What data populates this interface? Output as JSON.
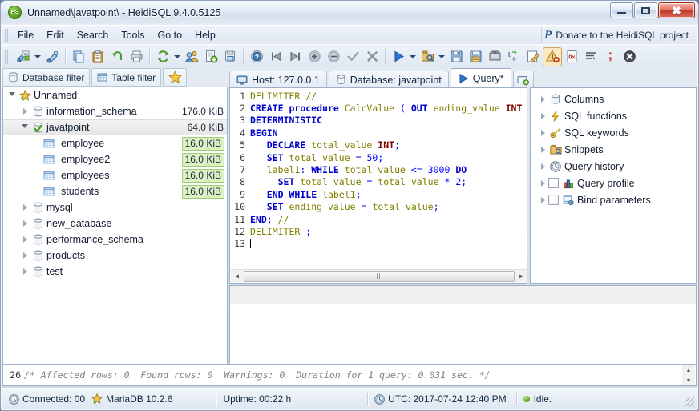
{
  "window": {
    "title": "Unnamed\\javatpoint\\ - HeidiSQL 9.4.0.5125",
    "app_icon": "HS",
    "minimize_label": "Minimize",
    "maximize_label": "Maximize",
    "close_label": "Close"
  },
  "menubar": {
    "items": [
      {
        "label": "File",
        "name": "menu-file"
      },
      {
        "label": "Edit",
        "name": "menu-edit"
      },
      {
        "label": "Search",
        "name": "menu-search"
      },
      {
        "label": "Tools",
        "name": "menu-tools"
      },
      {
        "label": "Go to",
        "name": "menu-goto"
      },
      {
        "label": "Help",
        "name": "menu-help"
      }
    ],
    "donate": {
      "icon": "paypal-icon",
      "glyph": "P",
      "label": "Donate to the HeidiSQL project"
    }
  },
  "toolbar": {
    "buttons": [
      {
        "name": "session-manager-icon",
        "tip": "Session manager"
      },
      {
        "name": "session-dropdown-caret",
        "tip": "Open session dropdown"
      },
      {
        "name": "new-session-icon",
        "tip": "Create new session"
      },
      {
        "name": "copy-icon",
        "tip": "Copy"
      },
      {
        "name": "paste-icon",
        "tip": "Paste"
      },
      {
        "name": "undo-icon",
        "tip": "Undo"
      },
      {
        "name": "print-icon",
        "tip": "Print"
      },
      {
        "name": "refresh-icon",
        "tip": "Refresh"
      },
      {
        "name": "refresh-dropdown-caret",
        "tip": "Refresh options"
      },
      {
        "name": "user-manager-icon",
        "tip": "User manager"
      },
      {
        "name": "export-database-icon",
        "tip": "Export database as SQL"
      },
      {
        "name": "import-dump-icon",
        "tip": "Import SQL dump"
      },
      {
        "name": "help-icon",
        "tip": "Help"
      },
      {
        "name": "first-icon",
        "tip": "First"
      },
      {
        "name": "last-icon",
        "tip": "Last"
      },
      {
        "name": "insert-row-icon",
        "tip": "Insert row"
      },
      {
        "name": "delete-row-icon",
        "tip": "Delete row"
      },
      {
        "name": "apply-icon",
        "tip": "Apply changes"
      },
      {
        "name": "cancel-icon",
        "tip": "Cancel changes"
      },
      {
        "name": "execute-sql-icon",
        "tip": "Execute SQL"
      },
      {
        "name": "execute-dropdown-caret",
        "tip": "Execute options"
      },
      {
        "name": "load-sql-icon",
        "tip": "Load SQL file"
      },
      {
        "name": "load-dropdown-caret",
        "tip": "Load options"
      },
      {
        "name": "save-sql-icon",
        "tip": "Save SQL"
      },
      {
        "name": "save-as-sql-icon",
        "tip": "Save SQL as"
      },
      {
        "name": "find-replace-icon",
        "tip": "Find / replace"
      },
      {
        "name": "format-sql-icon",
        "tip": "Format SQL"
      },
      {
        "name": "edit-highlight-icon",
        "tip": "Edit"
      },
      {
        "name": "stop-on-errors-icon",
        "tip": "Stop on errors",
        "pressed": true
      },
      {
        "name": "hex-view-icon",
        "tip": "Hex view"
      },
      {
        "name": "word-wrap-icon",
        "tip": "Word wrap"
      },
      {
        "name": "semicolon-icon",
        "tip": "Delimiter"
      },
      {
        "name": "close-tab-icon",
        "tip": "Close query tab"
      }
    ]
  },
  "left_panel": {
    "filter_tabs": [
      {
        "label": "Database filter",
        "icon": "database-icon",
        "name": "tab-database-filter"
      },
      {
        "label": "Table filter",
        "icon": "table-icon",
        "name": "tab-table-filter"
      }
    ],
    "favorites_icon": "star-icon",
    "tree": [
      {
        "label": "Unnamed",
        "size": "",
        "icon": "session-icon",
        "indent": 0,
        "expander": "open",
        "selected": false
      },
      {
        "label": "information_schema",
        "size": "176.0 KiB",
        "icon": "database-icon",
        "indent": 1,
        "expander": "closed",
        "selected": false
      },
      {
        "label": "javatpoint",
        "size": "64.0 KiB",
        "icon": "database-active-icon",
        "indent": 1,
        "expander": "open",
        "selected": true
      },
      {
        "label": "employee",
        "size": "16.0 KiB",
        "icon": "table-icon",
        "indent": 2,
        "expander": "none",
        "selected": false,
        "size_badge": true
      },
      {
        "label": "employee2",
        "size": "16.0 KiB",
        "icon": "table-icon",
        "indent": 2,
        "expander": "none",
        "selected": false,
        "size_badge": true
      },
      {
        "label": "employees",
        "size": "16.0 KiB",
        "icon": "table-icon",
        "indent": 2,
        "expander": "none",
        "selected": false,
        "size_badge": true
      },
      {
        "label": "students",
        "size": "16.0 KiB",
        "icon": "table-icon",
        "indent": 2,
        "expander": "none",
        "selected": false,
        "size_badge": true
      },
      {
        "label": "mysql",
        "size": "",
        "icon": "database-icon",
        "indent": 1,
        "expander": "closed",
        "selected": false
      },
      {
        "label": "new_database",
        "size": "",
        "icon": "database-icon",
        "indent": 1,
        "expander": "closed",
        "selected": false
      },
      {
        "label": "performance_schema",
        "size": "",
        "icon": "database-icon",
        "indent": 1,
        "expander": "closed",
        "selected": false
      },
      {
        "label": "products",
        "size": "",
        "icon": "database-icon",
        "indent": 1,
        "expander": "closed",
        "selected": false
      },
      {
        "label": "test",
        "size": "",
        "icon": "database-icon",
        "indent": 1,
        "expander": "closed",
        "selected": false
      }
    ]
  },
  "tabs": [
    {
      "label": "Host: 127.0.0.1",
      "icon": "host-icon",
      "active": false,
      "name": "tab-host"
    },
    {
      "label": "Database: javatpoint",
      "icon": "database-icon",
      "active": false,
      "name": "tab-database"
    },
    {
      "label": "Query*",
      "icon": "play-icon",
      "active": true,
      "name": "tab-query"
    }
  ],
  "new_tab_icon": "add-query-tab-icon",
  "editor": {
    "lines": [
      {
        "n": "1",
        "tokens": [
          {
            "t": "DELIMITER",
            "c": "ko"
          },
          {
            "t": " //",
            "c": "cm"
          }
        ]
      },
      {
        "n": "2",
        "tokens": [
          {
            "t": "CREATE",
            "c": "k"
          },
          {
            "t": " ",
            "c": "pl"
          },
          {
            "t": "procedure",
            "c": "k"
          },
          {
            "t": " ",
            "c": "pl"
          },
          {
            "t": "CalcValue",
            "c": "ko"
          },
          {
            "t": " ",
            "c": "pl"
          },
          {
            "t": "(",
            "c": "num"
          },
          {
            "t": " ",
            "c": "pl"
          },
          {
            "t": "OUT",
            "c": "k"
          },
          {
            "t": " ",
            "c": "pl"
          },
          {
            "t": "ending_value",
            "c": "ko"
          },
          {
            "t": " ",
            "c": "pl"
          },
          {
            "t": "INT",
            "c": "kt"
          }
        ]
      },
      {
        "n": "3",
        "tokens": [
          {
            "t": "DETERMINISTIC",
            "c": "k"
          }
        ]
      },
      {
        "n": "4",
        "tokens": [
          {
            "t": "BEGIN",
            "c": "k"
          }
        ]
      },
      {
        "n": "5",
        "tokens": [
          {
            "t": "   ",
            "c": "pl"
          },
          {
            "t": "DECLARE",
            "c": "k"
          },
          {
            "t": " ",
            "c": "pl"
          },
          {
            "t": "total_value",
            "c": "ko"
          },
          {
            "t": " ",
            "c": "pl"
          },
          {
            "t": "INT",
            "c": "kt"
          },
          {
            "t": ";",
            "c": "num"
          }
        ]
      },
      {
        "n": "6",
        "tokens": [
          {
            "t": "   ",
            "c": "pl"
          },
          {
            "t": "SET",
            "c": "k"
          },
          {
            "t": " ",
            "c": "pl"
          },
          {
            "t": "total_value",
            "c": "ko"
          },
          {
            "t": " ",
            "c": "pl"
          },
          {
            "t": "=",
            "c": "num"
          },
          {
            "t": " ",
            "c": "pl"
          },
          {
            "t": "50",
            "c": "num"
          },
          {
            "t": ";",
            "c": "num"
          }
        ]
      },
      {
        "n": "7",
        "tokens": [
          {
            "t": "   ",
            "c": "pl"
          },
          {
            "t": "label1",
            "c": "ko"
          },
          {
            "t": ": ",
            "c": "num"
          },
          {
            "t": "WHILE",
            "c": "k"
          },
          {
            "t": " ",
            "c": "pl"
          },
          {
            "t": "total_value",
            "c": "ko"
          },
          {
            "t": " ",
            "c": "pl"
          },
          {
            "t": "<=",
            "c": "num"
          },
          {
            "t": " ",
            "c": "pl"
          },
          {
            "t": "3000",
            "c": "num"
          },
          {
            "t": " ",
            "c": "pl"
          },
          {
            "t": "DO",
            "c": "k"
          }
        ]
      },
      {
        "n": "8",
        "tokens": [
          {
            "t": "     ",
            "c": "pl"
          },
          {
            "t": "SET",
            "c": "k"
          },
          {
            "t": " ",
            "c": "pl"
          },
          {
            "t": "total_value",
            "c": "ko"
          },
          {
            "t": " ",
            "c": "pl"
          },
          {
            "t": "=",
            "c": "num"
          },
          {
            "t": " ",
            "c": "pl"
          },
          {
            "t": "total_value",
            "c": "ko"
          },
          {
            "t": " ",
            "c": "pl"
          },
          {
            "t": "*",
            "c": "num"
          },
          {
            "t": " ",
            "c": "pl"
          },
          {
            "t": "2",
            "c": "num"
          },
          {
            "t": ";",
            "c": "num"
          }
        ]
      },
      {
        "n": "9",
        "tokens": [
          {
            "t": "   ",
            "c": "pl"
          },
          {
            "t": "END",
            "c": "k"
          },
          {
            "t": " ",
            "c": "pl"
          },
          {
            "t": "WHILE",
            "c": "k"
          },
          {
            "t": " ",
            "c": "pl"
          },
          {
            "t": "label1",
            "c": "ko"
          },
          {
            "t": ";",
            "c": "num"
          }
        ]
      },
      {
        "n": "10",
        "tokens": [
          {
            "t": "   ",
            "c": "pl"
          },
          {
            "t": "SET",
            "c": "k"
          },
          {
            "t": " ",
            "c": "pl"
          },
          {
            "t": "ending_value",
            "c": "ko"
          },
          {
            "t": " ",
            "c": "pl"
          },
          {
            "t": "=",
            "c": "num"
          },
          {
            "t": " ",
            "c": "pl"
          },
          {
            "t": "total_value",
            "c": "ko"
          },
          {
            "t": ";",
            "c": "num"
          }
        ]
      },
      {
        "n": "11",
        "tokens": [
          {
            "t": "END",
            "c": "k"
          },
          {
            "t": "; ",
            "c": "num"
          },
          {
            "t": "//",
            "c": "cm"
          }
        ]
      },
      {
        "n": "12",
        "tokens": [
          {
            "t": "DELIMITER",
            "c": "ko"
          },
          {
            "t": " ;",
            "c": "num"
          }
        ]
      },
      {
        "n": "13",
        "tokens": []
      }
    ],
    "plain_text": "DELIMITER //\nCREATE procedure CalcValue ( OUT ending_value INT\nDETERMINISTIC\nBEGIN\n   DECLARE total_value INT;\n   SET total_value = 50;\n   label1: WHILE total_value <= 3000 DO\n     SET total_value = total_value * 2;\n   END WHILE label1;\n   SET ending_value = total_value;\nEND; //\nDELIMITER ;\n"
  },
  "helper_panel": {
    "items": [
      {
        "label": "Columns",
        "icon": "database-icon",
        "checkbox": false,
        "name": "helper-columns"
      },
      {
        "label": "SQL functions",
        "icon": "lightning-icon",
        "checkbox": false,
        "name": "helper-sql-functions"
      },
      {
        "label": "SQL keywords",
        "icon": "key-icon",
        "checkbox": false,
        "name": "helper-sql-keywords"
      },
      {
        "label": "Snippets",
        "icon": "folder-search-icon",
        "checkbox": false,
        "name": "helper-snippets"
      },
      {
        "label": "Query history",
        "icon": "clock-icon",
        "checkbox": false,
        "name": "helper-query-history"
      },
      {
        "label": "Query profile",
        "icon": "bar-chart-icon",
        "checkbox": true,
        "name": "helper-query-profile"
      },
      {
        "label": "Bind parameters",
        "icon": "bind-icon",
        "checkbox": true,
        "name": "helper-bind-parameters"
      }
    ]
  },
  "log": {
    "line_number": "26",
    "text": "/* Affected rows: 0  Found rows: 0  Warnings: 0  Duration for 1 query: 0.031 sec. */"
  },
  "statusbar": {
    "connected": "Connected: 00",
    "server": "MariaDB 10.2.6",
    "uptime": "Uptime: 00:22 h",
    "utc": "UTC: 2017-07-24 12:40 PM",
    "state": "Idle.",
    "connected_icon": "clock-icon",
    "server_icon": "session-icon",
    "utc_icon": "clock-icon",
    "state_icon": "green-dot-icon"
  },
  "colors": {
    "accent": "#0000cc",
    "identifier": "#808000",
    "datatype": "#800000",
    "table_size_badge_bg": "#ddf0c3",
    "table_size_badge_border": "#9fcc70",
    "close_button": "#c03a2c"
  }
}
